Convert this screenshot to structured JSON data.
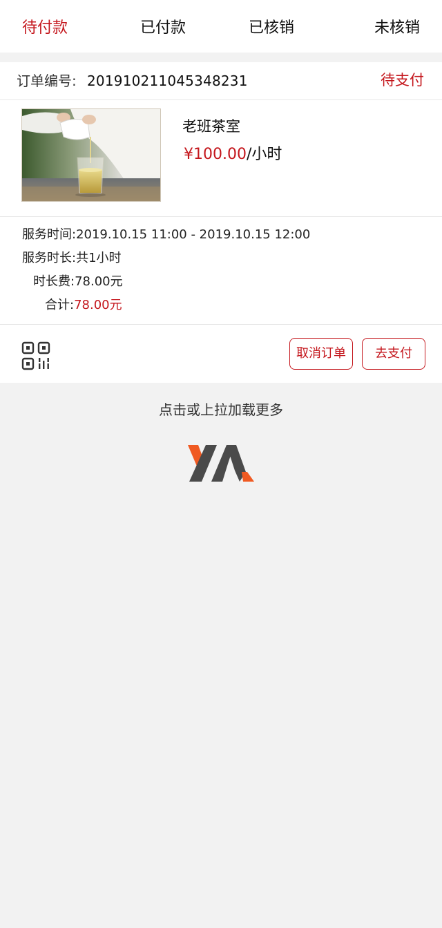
{
  "tabs": [
    {
      "label": "待付款",
      "active": true
    },
    {
      "label": "已付款",
      "active": false
    },
    {
      "label": "已核销",
      "active": false
    },
    {
      "label": "未核销",
      "active": false
    }
  ],
  "order": {
    "number_label": "订单编号:",
    "number": "201910211045348231",
    "status": "待支付",
    "product": {
      "name": "老班茶室",
      "price": "¥100.00",
      "unit": "/小时",
      "image": "tea-pouring-photo"
    },
    "details": {
      "service_time_label": "服务时间:",
      "service_time": "2019.10.15 11:00 - 2019.10.15 12:00",
      "duration_label": "服务时长:",
      "duration": "共1小时",
      "fee_label": "时长费:",
      "fee": "78.00元",
      "total_label": "合计:",
      "total": "78.00元"
    },
    "actions": {
      "qr_icon": "qr-code-icon",
      "cancel_label": "取消订单",
      "pay_label": "去支付"
    }
  },
  "load_more": "点击或上拉加载更多",
  "logo": "ym-logo",
  "colors": {
    "accent": "#c4161c",
    "background": "#f2f2f2",
    "logo_gray": "#4a4a4a",
    "logo_orange": "#f05a22"
  }
}
